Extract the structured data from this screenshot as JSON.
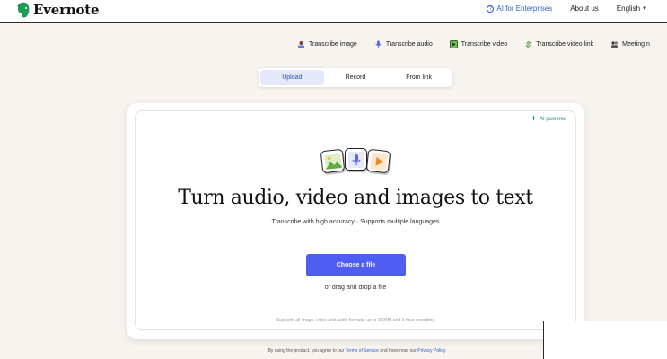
{
  "header": {
    "logo_text": "Evernote",
    "ai_enterprises": "AI for Enterprises",
    "about": "About us",
    "language": "English"
  },
  "tools": [
    {
      "label": "Transcribe image",
      "icon": "image-icon"
    },
    {
      "label": "Transcribe audio",
      "icon": "mic-icon"
    },
    {
      "label": "Transcribe video",
      "icon": "play-icon"
    },
    {
      "label": "Transcribe video link",
      "icon": "link-icon"
    },
    {
      "label": "Meeting n",
      "icon": "meeting-icon"
    }
  ],
  "tabs": [
    {
      "label": "Upload",
      "active": true
    },
    {
      "label": "Record",
      "active": false
    },
    {
      "label": "From link",
      "active": false
    }
  ],
  "card": {
    "ai_powered": "AI powered",
    "headline": "Turn audio, video and images to text",
    "subline": "Transcribe with high accuracy · Supports multiple languages",
    "choose_button": "Choose a file",
    "drag_text": "or drag and drop a file",
    "supports": "Supports all image, video and audio formats, up to 100MB and 1 hour recording"
  },
  "footer": {
    "prefix": "By using the product, you agree to our",
    "terms": "Terms of Service",
    "middle": "and have read our",
    "privacy": "Privacy Policy",
    "suffix": "."
  },
  "colors": {
    "accent": "#4f5df0",
    "link": "#2e5ec9",
    "page_bg": "#f7f4ef",
    "tab_active_bg": "#e3e9fb"
  }
}
